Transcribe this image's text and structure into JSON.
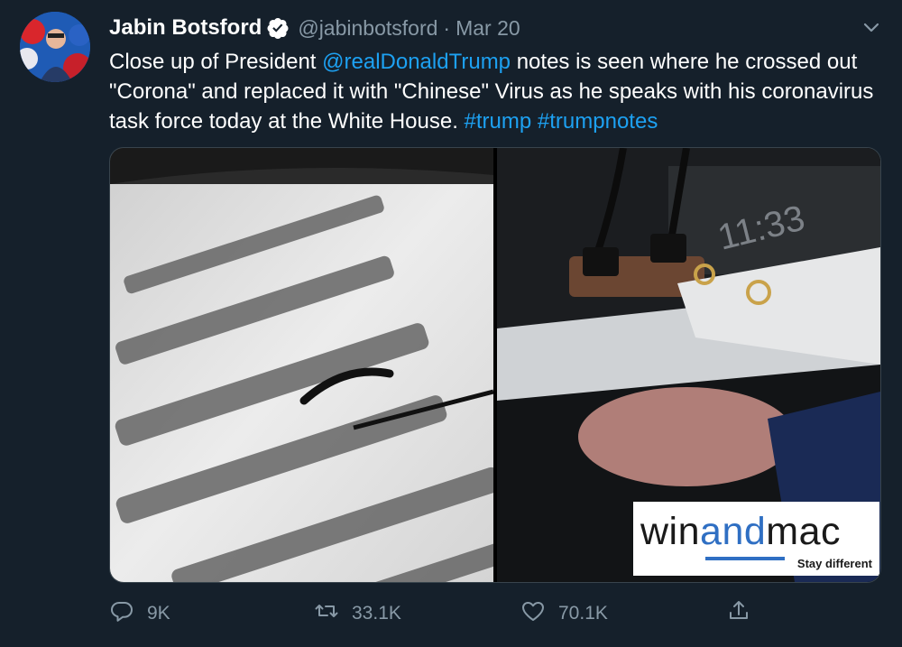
{
  "tweet": {
    "author_name": "Jabin Botsford",
    "handle": "@jabinbotsford",
    "separator": "·",
    "date": "Mar 20",
    "text_parts": {
      "p1": "Close up of President ",
      "mention": "@realDonaldTrump",
      "p2": " notes is seen where he crossed out \"Corona\" and replaced it with \"Chinese\" Virus as he speaks with his coronavirus task force today at the White House. ",
      "hashtag1": "#trump",
      "space": " ",
      "hashtag2": "#trumpnotes"
    }
  },
  "media": {
    "left_image": "notes-closeup",
    "right_image": "podium-notes",
    "clock_text": "11:33",
    "watermark": {
      "main_a": "win",
      "main_b": "and",
      "main_c": "mac",
      "tagline": "Stay different"
    }
  },
  "actions": {
    "reply_count": "9K",
    "retweet_count": "33.1K",
    "like_count": "70.1K"
  },
  "colors": {
    "background": "#15202b",
    "accent": "#1da1f2",
    "secondary_text": "#8899a6"
  }
}
